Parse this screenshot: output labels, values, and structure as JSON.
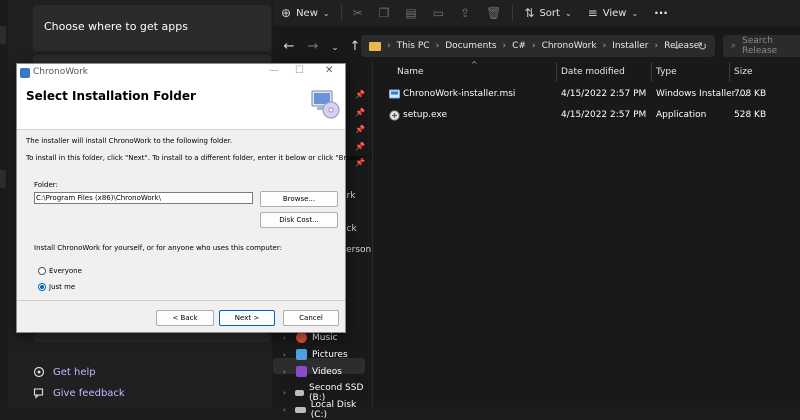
{
  "settings": {
    "choose_apps": "Choose where to get apps",
    "get_help": "Get help",
    "give_feedback": "Give feedback"
  },
  "explorer": {
    "toolbar": {
      "new": "New",
      "sort": "Sort",
      "view": "View",
      "more": "···"
    },
    "breadcrumbs": [
      "This PC",
      "Documents",
      "C#",
      "ChronoWork",
      "Installer",
      "Release"
    ],
    "search_placeholder": "Search Release",
    "columns": [
      "Name",
      "Date modified",
      "Type",
      "Size"
    ],
    "files": [
      {
        "name": "ChronoWork-installer.msi",
        "date": "4/15/2022 2:57 PM",
        "type": "Windows Installer ...",
        "size": "708 KB"
      },
      {
        "name": "setup.exe",
        "date": "4/15/2022 2:57 PM",
        "type": "Application",
        "size": "528 KB"
      }
    ],
    "nav_fragments": [
      "s",
      "s",
      "ork",
      "ack",
      "Person"
    ],
    "nav_items": [
      "Music",
      "Pictures",
      "Videos",
      "Second SSD (B:)",
      "Local Disk (C:)"
    ]
  },
  "installer": {
    "window_title": "ChronoWork",
    "heading": "Select Installation Folder",
    "intro": "The installer will install ChronoWork to the following folder.",
    "instructions": "To install in this folder, click \"Next\". To install to a different folder, enter it below or click \"Browse\".",
    "folder_label": "Folder:",
    "folder_value": "C:\\Program Files (x86)\\ChronoWork\\",
    "browse": "Browse...",
    "disk_cost": "Disk Cost...",
    "install_for": "Install ChronoWork for yourself, or for anyone who uses this computer:",
    "everyone": "Everyone",
    "just_me": "Just me",
    "back": "< Back",
    "next": "Next >",
    "cancel": "Cancel",
    "selected_option": "Just me"
  },
  "colors": {
    "accent": "#0067c0",
    "link": "#c7b6ff",
    "folder": "#e8b84a"
  }
}
